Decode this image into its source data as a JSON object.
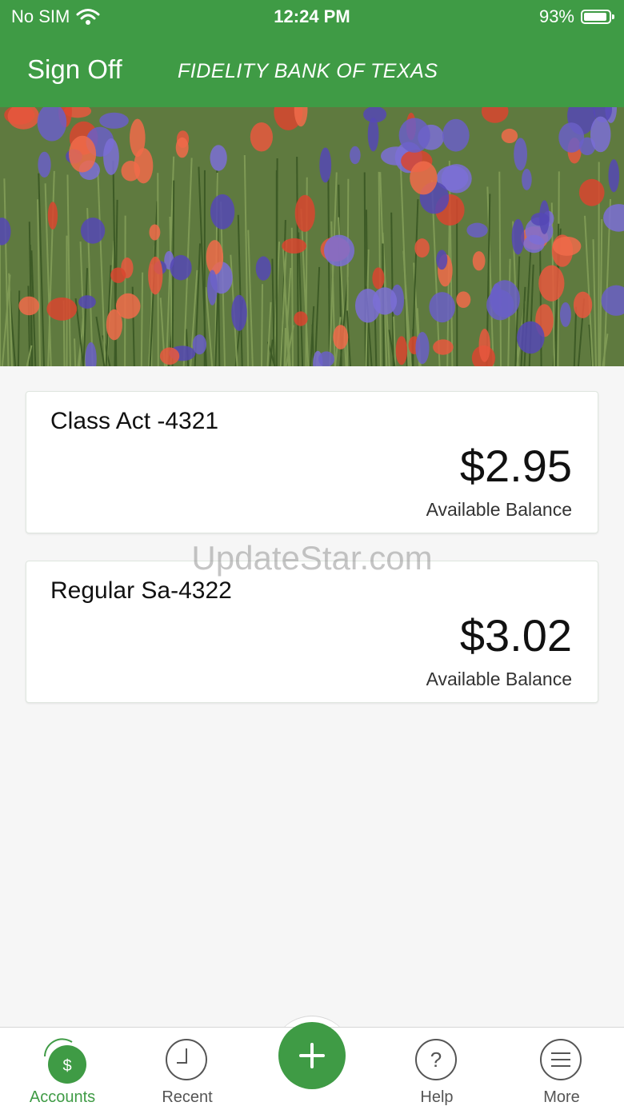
{
  "status_bar": {
    "carrier": "No SIM",
    "time": "12:24 PM",
    "battery_percent": "93%",
    "battery_level": 0.93
  },
  "header": {
    "sign_off_label": "Sign Off",
    "bank_name": "FIDELITY BANK OF TEXAS",
    "color": "#3f9b45"
  },
  "accounts": [
    {
      "name": "Class Act -4321",
      "amount": "$2.95",
      "label": "Available Balance"
    },
    {
      "name": "Regular Sa-4322",
      "amount": "$3.02",
      "label": "Available Balance"
    }
  ],
  "watermark": "UpdateStar.com",
  "tabbar": {
    "items": [
      {
        "label": "Accounts",
        "icon": "dollar-icon",
        "active": true
      },
      {
        "label": "Recent",
        "icon": "clock-icon",
        "active": false
      },
      {
        "label": "",
        "icon": "plus-icon",
        "active": false
      },
      {
        "label": "Help",
        "icon": "question-icon",
        "active": false
      },
      {
        "label": "More",
        "icon": "menu-icon",
        "active": false
      }
    ],
    "accent": "#3f9b45"
  }
}
